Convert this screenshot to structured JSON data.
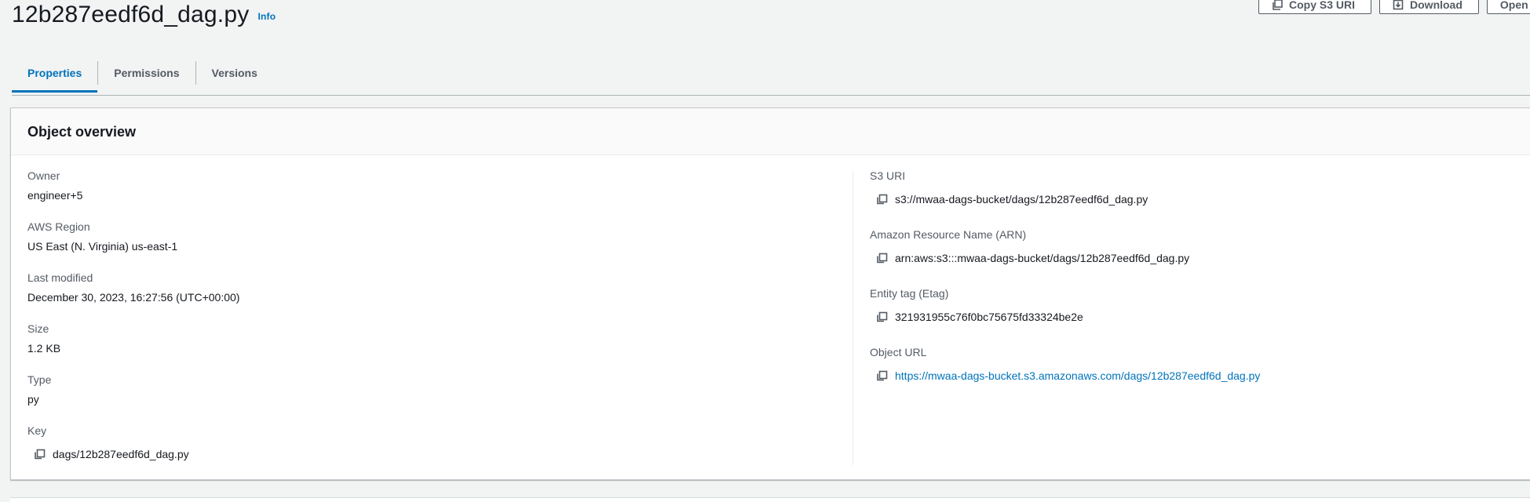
{
  "header": {
    "title": "12b287eedf6d_dag.py",
    "info": "Info",
    "actions": [
      {
        "label": "Copy S3 URI",
        "icon": "copy-icon"
      },
      {
        "label": "Download",
        "icon": "download-icon"
      },
      {
        "label": "Open",
        "icon": "external-link-icon"
      }
    ]
  },
  "tabs": [
    {
      "label": "Properties",
      "active": true
    },
    {
      "label": "Permissions",
      "active": false
    },
    {
      "label": "Versions",
      "active": false
    }
  ],
  "overview": {
    "title": "Object overview",
    "left": {
      "owner": {
        "label": "Owner",
        "value": "engineer+5"
      },
      "region": {
        "label": "AWS Region",
        "value": "US East (N. Virginia) us-east-1"
      },
      "modified": {
        "label": "Last modified",
        "value": "December 30, 2023, 16:27:56 (UTC+00:00)"
      },
      "size": {
        "label": "Size",
        "value": "1.2 KB"
      },
      "type": {
        "label": "Type",
        "value": "py"
      },
      "key": {
        "label": "Key",
        "value": "dags/12b287eedf6d_dag.py"
      }
    },
    "right": {
      "s3uri": {
        "label": "S3 URI",
        "value": "s3://mwaa-dags-bucket/dags/12b287eedf6d_dag.py"
      },
      "arn": {
        "label": "Amazon Resource Name (ARN)",
        "value": "arn:aws:s3:::mwaa-dags-bucket/dags/12b287eedf6d_dag.py"
      },
      "etag": {
        "label": "Entity tag (Etag)",
        "value": "321931955c76f0bc75675fd33324be2e"
      },
      "url": {
        "label": "Object URL",
        "value": "https://mwaa-dags-bucket.s3.amazonaws.com/dags/12b287eedf6d_dag.py"
      }
    }
  },
  "colors": {
    "link": "#0073bb",
    "text": "#16191f",
    "label": "#545b64",
    "background": "#f2f3f3"
  }
}
